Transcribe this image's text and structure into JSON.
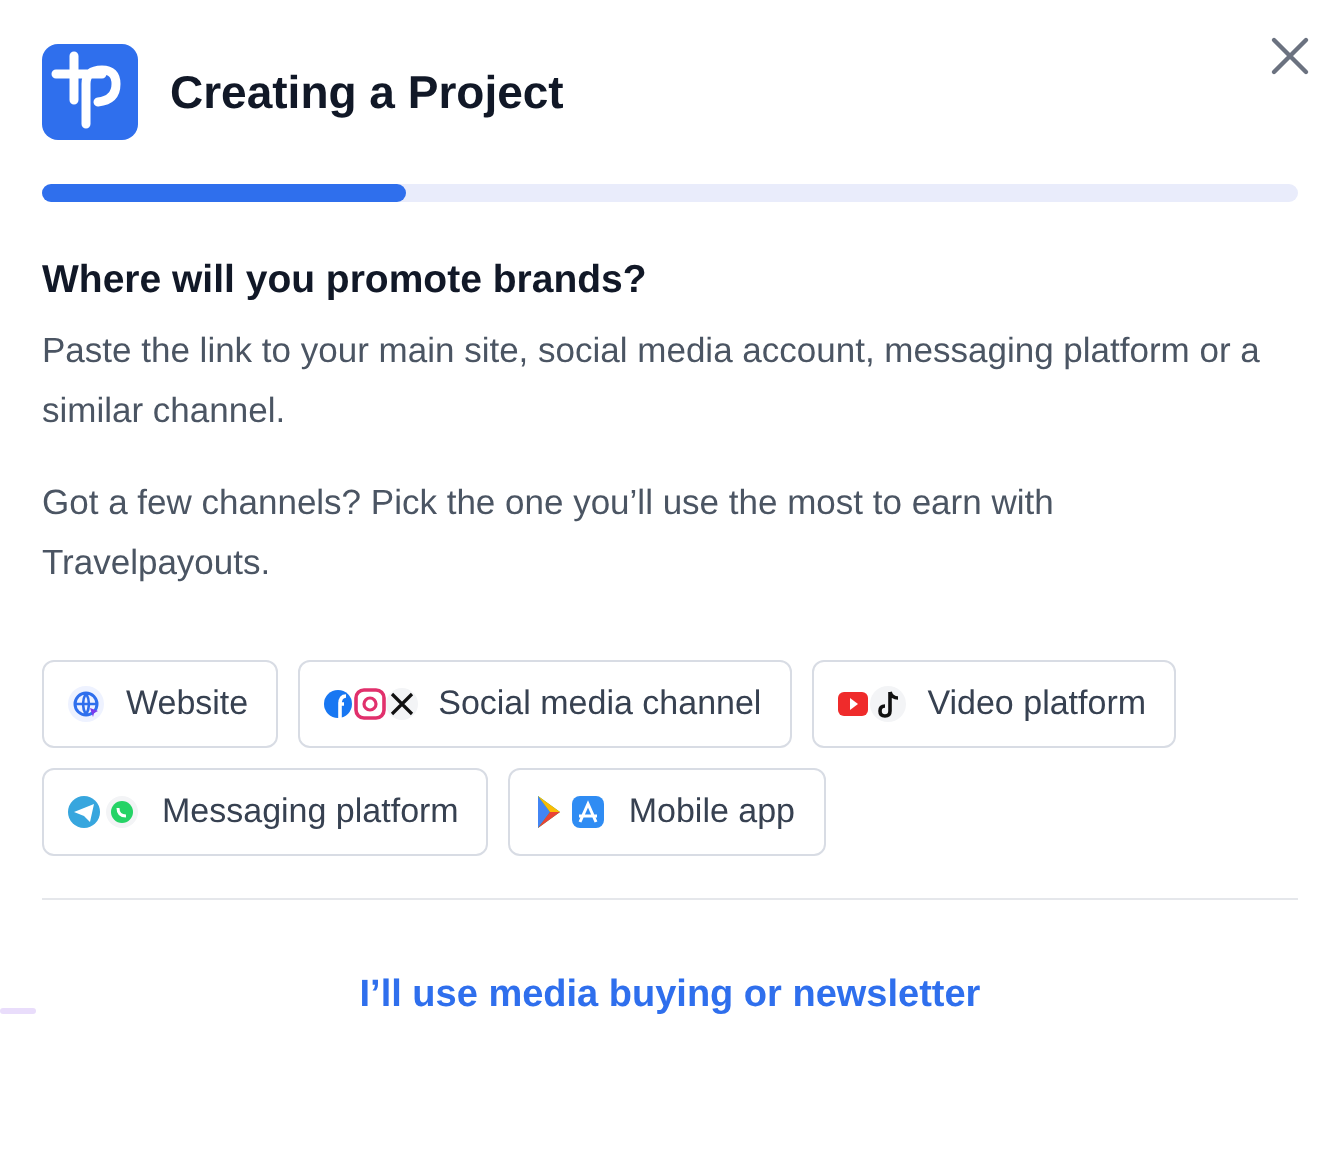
{
  "dialog": {
    "title": "Creating a Project",
    "progress": {
      "level": 0.29
    }
  },
  "question": {
    "heading": "Where will you promote brands?",
    "paragraphs": [
      "Paste the link to your main site, social media account, messaging platform or a similar channel.",
      "Got a few channels? Pick the one you’ll use the most to earn with Travelpayouts."
    ]
  },
  "channels": [
    {
      "kind": "website",
      "label": "Website"
    },
    {
      "kind": "social",
      "label": "Social media channel"
    },
    {
      "kind": "video",
      "label": "Video platform"
    },
    {
      "kind": "messaging",
      "label": "Messaging platform"
    },
    {
      "kind": "mobile",
      "label": "Mobile app"
    }
  ],
  "alt_link": "I’ll use media buying or newsletter"
}
